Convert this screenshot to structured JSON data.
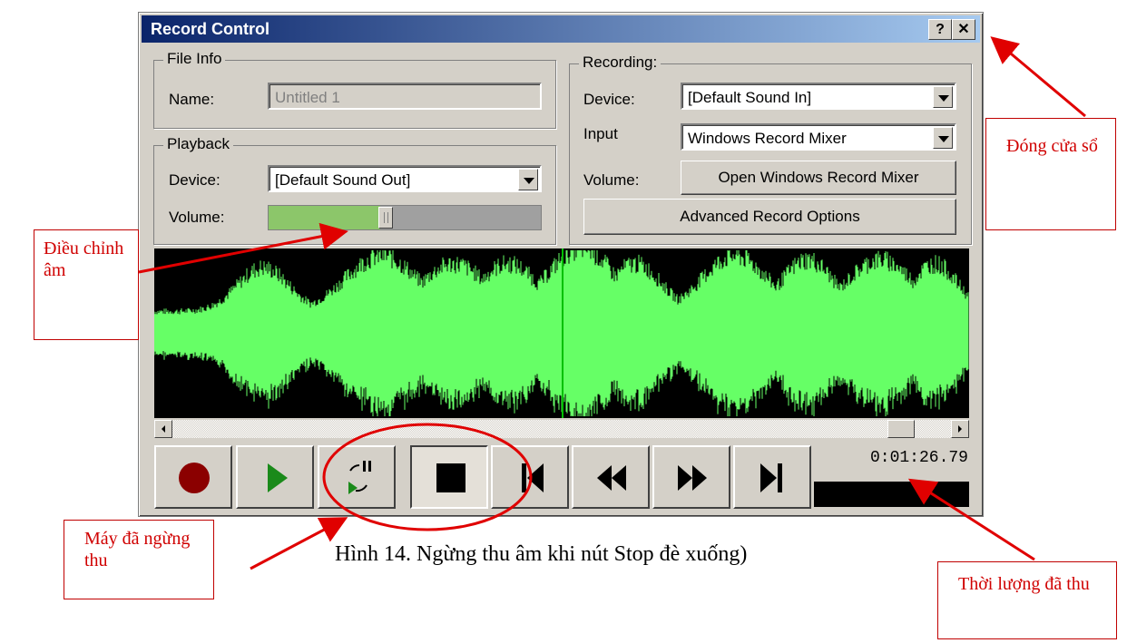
{
  "window": {
    "title": "Record Control",
    "help_button": "?",
    "close_button": "✕"
  },
  "file_info": {
    "group_label": "File Info",
    "name_label": "Name:",
    "name_value": "Untitled 1"
  },
  "playback": {
    "group_label": "Playback",
    "device_label": "Device:",
    "device_value": "[Default Sound Out]",
    "volume_label": "Volume:",
    "volume_level": 0.41
  },
  "recording": {
    "group_label": "Recording:",
    "device_label": "Device:",
    "device_value": "[Default Sound In]",
    "input_label": "Input",
    "input_value": "Windows Record Mixer",
    "volume_label": "Volume:",
    "open_mixer_button": "Open Windows Record Mixer",
    "advanced_button": "Advanced Record Options"
  },
  "transport": {
    "buttons": [
      "record",
      "play",
      "pause-loop",
      "stop",
      "go-to-start",
      "rewind",
      "fast-forward",
      "go-to-end"
    ],
    "pressed": "stop",
    "time": "0:01:26.79"
  },
  "colors": {
    "waveform": "#66ff66",
    "title_start": "#0a246a",
    "title_end": "#a6caf0",
    "record": "#8b0000",
    "play": "#1a8a1a",
    "annotation": "#e00000"
  },
  "annotations": {
    "close_window": "Đóng cửa sổ",
    "adjust_volume": "Điều chỉnh âm",
    "stopped": "Máy đã ngừng thu",
    "duration": "Thời lượng đã thu"
  },
  "caption": "Hình 14. Ngừng thu âm khi nút Stop đè xuống)"
}
